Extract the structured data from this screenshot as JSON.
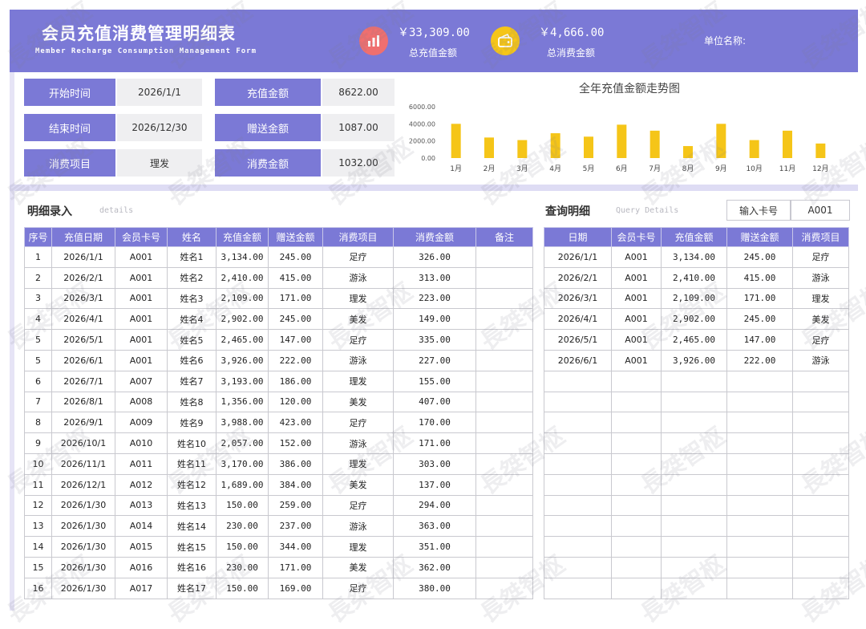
{
  "header": {
    "title": "会员充值消费管理明细表",
    "subtitle": "Member Recharge Consumption Management Form",
    "total_recharge_value": "￥33,309.00",
    "total_recharge_label": "总充值金额",
    "total_consume_value": "￥4,666.00",
    "total_consume_label": "总消费金额",
    "unit_label": "单位名称:"
  },
  "info": {
    "start_label": "开始时间",
    "start_value": "2026/1/1",
    "end_label": "结束时间",
    "end_value": "2026/12/30",
    "item_label": "消费项目",
    "item_value": "理发",
    "recharge_label": "充值金额",
    "recharge_value": "8622.00",
    "gift_label": "赠送金额",
    "gift_value": "1087.00",
    "consume_label": "消费金额",
    "consume_value": "1032.00"
  },
  "chart_data": {
    "type": "bar",
    "title": "全年充值金额走势图",
    "categories": [
      "1月",
      "2月",
      "3月",
      "4月",
      "5月",
      "6月",
      "7月",
      "8月",
      "9月",
      "10月",
      "11月",
      "12月"
    ],
    "values": [
      4000,
      2400,
      2100,
      2900,
      2500,
      3900,
      3200,
      1400,
      4000,
      2100,
      3200,
      1700
    ],
    "yticks": [
      "6000.00",
      "4000.00",
      "2000.00",
      "0.00"
    ],
    "ylim": [
      0,
      6000
    ],
    "color": "#f5c518"
  },
  "detail": {
    "title": "明细录入",
    "subtitle": "details",
    "headers": [
      "序号",
      "充值日期",
      "会员卡号",
      "姓名",
      "充值金额",
      "赠送金额",
      "消费项目",
      "消费金额",
      "备注"
    ],
    "rows": [
      [
        "1",
        "2026/1/1",
        "A001",
        "姓名1",
        "3,134.00",
        "245.00",
        "足疗",
        "326.00",
        ""
      ],
      [
        "2",
        "2026/2/1",
        "A001",
        "姓名2",
        "2,410.00",
        "415.00",
        "游泳",
        "313.00",
        ""
      ],
      [
        "3",
        "2026/3/1",
        "A001",
        "姓名3",
        "2,109.00",
        "171.00",
        "理发",
        "223.00",
        ""
      ],
      [
        "4",
        "2026/4/1",
        "A001",
        "姓名4",
        "2,902.00",
        "245.00",
        "美发",
        "149.00",
        ""
      ],
      [
        "5",
        "2026/5/1",
        "A001",
        "姓名5",
        "2,465.00",
        "147.00",
        "足疗",
        "335.00",
        ""
      ],
      [
        "5",
        "2026/6/1",
        "A001",
        "姓名6",
        "3,926.00",
        "222.00",
        "游泳",
        "227.00",
        ""
      ],
      [
        "6",
        "2026/7/1",
        "A007",
        "姓名7",
        "3,193.00",
        "186.00",
        "理发",
        "155.00",
        ""
      ],
      [
        "7",
        "2026/8/1",
        "A008",
        "姓名8",
        "1,356.00",
        "120.00",
        "美发",
        "407.00",
        ""
      ],
      [
        "8",
        "2026/9/1",
        "A009",
        "姓名9",
        "3,988.00",
        "423.00",
        "足疗",
        "170.00",
        ""
      ],
      [
        "9",
        "2026/10/1",
        "A010",
        "姓名10",
        "2,057.00",
        "152.00",
        "游泳",
        "171.00",
        ""
      ],
      [
        "10",
        "2026/11/1",
        "A011",
        "姓名11",
        "3,170.00",
        "386.00",
        "理发",
        "303.00",
        ""
      ],
      [
        "11",
        "2026/12/1",
        "A012",
        "姓名12",
        "1,689.00",
        "384.00",
        "美发",
        "137.00",
        ""
      ],
      [
        "12",
        "2026/1/30",
        "A013",
        "姓名13",
        "150.00",
        "259.00",
        "足疗",
        "294.00",
        ""
      ],
      [
        "13",
        "2026/1/30",
        "A014",
        "姓名14",
        "230.00",
        "237.00",
        "游泳",
        "363.00",
        ""
      ],
      [
        "14",
        "2026/1/30",
        "A015",
        "姓名15",
        "150.00",
        "344.00",
        "理发",
        "351.00",
        ""
      ],
      [
        "15",
        "2026/1/30",
        "A016",
        "姓名16",
        "230.00",
        "171.00",
        "美发",
        "362.00",
        ""
      ],
      [
        "16",
        "2026/1/30",
        "A017",
        "姓名17",
        "150.00",
        "169.00",
        "足疗",
        "380.00",
        ""
      ]
    ]
  },
  "query": {
    "title": "查询明细",
    "subtitle": "Query Details",
    "card_label": "输入卡号",
    "card_value": "A001",
    "headers": [
      "日期",
      "会员卡号",
      "充值金额",
      "赠送金额",
      "消费项目"
    ],
    "rows": [
      [
        "2026/1/1",
        "A001",
        "3,134.00",
        "245.00",
        "足疗"
      ],
      [
        "2026/2/1",
        "A001",
        "2,410.00",
        "415.00",
        "游泳"
      ],
      [
        "2026/3/1",
        "A001",
        "2,109.00",
        "171.00",
        "理发"
      ],
      [
        "2026/4/1",
        "A001",
        "2,902.00",
        "245.00",
        "美发"
      ],
      [
        "2026/5/1",
        "A001",
        "2,465.00",
        "147.00",
        "足疗"
      ],
      [
        "2026/6/1",
        "A001",
        "3,926.00",
        "222.00",
        "游泳"
      ],
      [
        "",
        "",
        "",
        "",
        ""
      ],
      [
        "",
        "",
        "",
        "",
        ""
      ],
      [
        "",
        "",
        "",
        "",
        ""
      ],
      [
        "",
        "",
        "",
        "",
        ""
      ],
      [
        "",
        "",
        "",
        "",
        ""
      ],
      [
        "",
        "",
        "",
        "",
        ""
      ],
      [
        "",
        "",
        "",
        "",
        ""
      ],
      [
        "",
        "",
        "",
        "",
        ""
      ],
      [
        "",
        "",
        "",
        "",
        ""
      ],
      [
        "",
        "",
        "",
        "",
        ""
      ],
      [
        "",
        "",
        "",
        "",
        ""
      ]
    ]
  },
  "icons": {
    "recharge_icon": "bar-chart-icon",
    "consume_icon": "wallet-icon",
    "recharge_icon_color": "#ef6f6f",
    "consume_icon_color": "#f5c518"
  },
  "watermark": "長桀智枢"
}
